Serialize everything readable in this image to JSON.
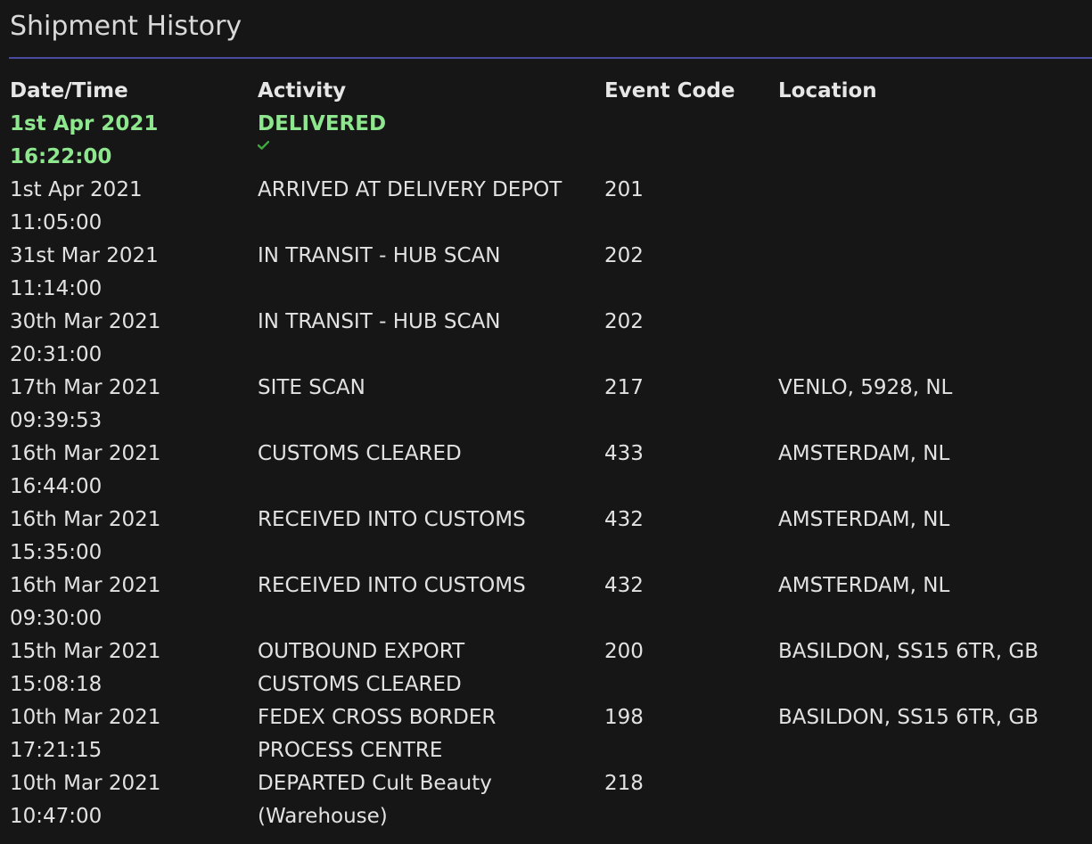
{
  "title": "Shipment History",
  "colors": {
    "delivered": "#8ee68e",
    "check": "#3fa83f",
    "divider": "#4a4aa0"
  },
  "headers": {
    "date": "Date/Time",
    "activity": "Activity",
    "code": "Event Code",
    "location": "Location"
  },
  "rows": [
    {
      "date": "1st Apr 2021",
      "time": "16:22:00",
      "activity": [
        "DELIVERED"
      ],
      "code": "",
      "location": "",
      "status_icon": "check-icon"
    },
    {
      "date": "1st Apr 2021",
      "time": "11:05:00",
      "activity": [
        "ARRIVED AT DELIVERY DEPOT"
      ],
      "code": "201",
      "location": ""
    },
    {
      "date": "31st Mar 2021",
      "time": "11:14:00",
      "activity": [
        "IN TRANSIT - HUB SCAN"
      ],
      "code": "202",
      "location": ""
    },
    {
      "date": "30th Mar 2021",
      "time": "20:31:00",
      "activity": [
        "IN TRANSIT - HUB SCAN"
      ],
      "code": "202",
      "location": ""
    },
    {
      "date": "17th Mar 2021",
      "time": "09:39:53",
      "activity": [
        "SITE SCAN"
      ],
      "code": "217",
      "location": "VENLO, 5928, NL"
    },
    {
      "date": "16th Mar 2021",
      "time": "16:44:00",
      "activity": [
        "CUSTOMS CLEARED"
      ],
      "code": "433",
      "location": "AMSTERDAM, NL"
    },
    {
      "date": "16th Mar 2021",
      "time": "15:35:00",
      "activity": [
        "RECEIVED INTO CUSTOMS"
      ],
      "code": "432",
      "location": "AMSTERDAM, NL"
    },
    {
      "date": "16th Mar 2021",
      "time": "09:30:00",
      "activity": [
        "RECEIVED INTO CUSTOMS"
      ],
      "code": "432",
      "location": "AMSTERDAM, NL"
    },
    {
      "date": "15th Mar 2021",
      "time": "15:08:18",
      "activity": [
        "OUTBOUND EXPORT",
        "CUSTOMS CLEARED"
      ],
      "code": "200",
      "location": "BASILDON, SS15 6TR, GB"
    },
    {
      "date": "10th Mar 2021",
      "time": "17:21:15",
      "activity": [
        "FEDEX CROSS BORDER",
        "PROCESS CENTRE"
      ],
      "code": "198",
      "location": "BASILDON, SS15 6TR, GB"
    },
    {
      "date": "10th Mar 2021",
      "time": "10:47:00",
      "activity": [
        "DEPARTED Cult Beauty",
        "(Warehouse)"
      ],
      "code": "218",
      "location": ""
    }
  ]
}
